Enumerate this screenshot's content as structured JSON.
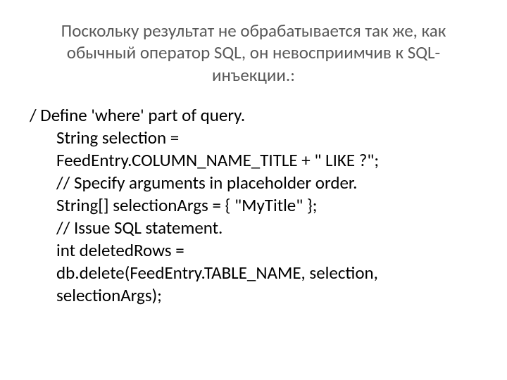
{
  "heading": "Поскольку результат не обрабатывается так же, как обычный оператор SQL, он невосприимчив к SQL-инъекции.:",
  "code": {
    "line1": "/ Define 'where' part of query.",
    "line2": "String selection =",
    "line3": "FeedEntry.COLUMN_NAME_TITLE + \" LIKE ?\";",
    "line4": "// Specify arguments in placeholder order.",
    "line5": "String[] selectionArgs = { \"MyTitle\" };",
    "line6": "// Issue SQL statement.",
    "line7": "int deletedRows =",
    "line8": "db.delete(FeedEntry.TABLE_NAME, selection,",
    "line9": "selectionArgs);"
  }
}
